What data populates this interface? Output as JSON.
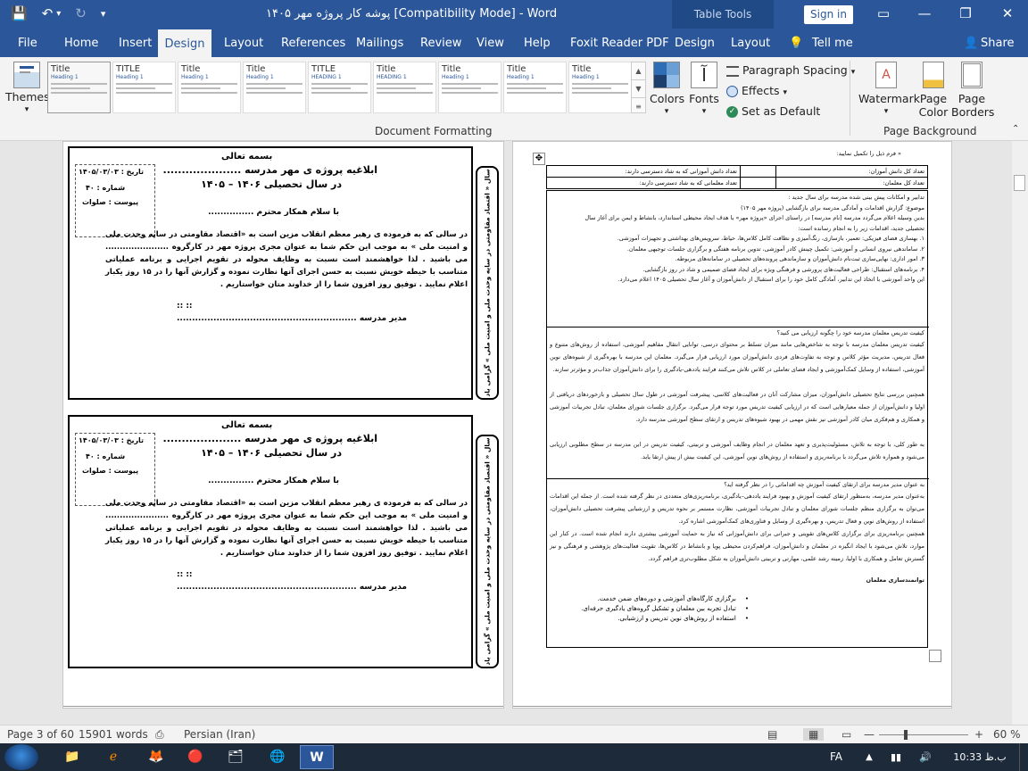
{
  "window": {
    "title": "پوشه کار پروژه مهر ۱۴۰۵ [Compatibility Mode]  -  Word",
    "contextual": "Table Tools",
    "signin": "Sign in",
    "minimize": "—",
    "restore": "❐",
    "close": "✕"
  },
  "qat": {
    "save": "💾",
    "undo": "↶",
    "undo_dd": "▾",
    "redo": "↻",
    "customize": "▾"
  },
  "tabs": [
    "File",
    "Home",
    "Insert",
    "Design",
    "Layout",
    "References",
    "Mailings",
    "Review",
    "View",
    "Help",
    "Foxit Reader PDF",
    "Design",
    "Layout",
    "Tell me",
    "Share"
  ],
  "tell_icon": "💡",
  "share_icon": "👤",
  "ribbon": {
    "themes": "Themes",
    "themes_dd": "▾",
    "styles": [
      {
        "t": "Title",
        "h": "Heading 1"
      },
      {
        "t": "TITLE",
        "h": "Heading 1"
      },
      {
        "t": "Title",
        "h": "Heading 1"
      },
      {
        "t": "Title",
        "h": "Heading 1"
      },
      {
        "t": "TITLE",
        "h": "HEADING 1"
      },
      {
        "t": "Title",
        "h": "HEADING 1"
      },
      {
        "t": "Title",
        "h": "Heading 1"
      },
      {
        "t": "Title",
        "h": "Heading 1"
      },
      {
        "t": "Title",
        "h": "Heading 1"
      }
    ],
    "gallery_up": "▲",
    "gallery_down": "▼",
    "gallery_more": "≡",
    "colors": "Colors",
    "fonts": "Fonts",
    "fonts_glyph": "آ",
    "paragraph_spacing": "Paragraph Spacing",
    "effects": "Effects",
    "set_default": "Set as Default",
    "dd": "▾",
    "doc_formatting": "Document Formatting",
    "watermark": "Watermark",
    "page_color": "Page Color",
    "page_color2": "Color",
    "page_borders": "Page Borders",
    "page_borders2": "Borders",
    "page_color1": "Page",
    "page_borders1": "Page",
    "page_background": "Page Background",
    "collapse": "⌃"
  },
  "doc": {
    "card": {
      "basmala": "بسمه تعالی",
      "title1": "ابلاغیه پروژه ی مهر مدرسه  .....................",
      "title2": "در سال تحصیلی ۱۴۰۶ – ۱۴۰۵",
      "date": "تاریخ : ۱۴۰۵/۰۳/۰۳",
      "number": "شماره : ۴۰",
      "attach": "پیوست : صلوات",
      "greet": "با سلام همکار محترم ...............",
      "body": "در سالی که به فرموده ی رهبر معظم انقلاب مزین است به «اقتصاد مقاومتی در سایه وحدت ملی و امنیت ملی » به موجب این حکم شما به عنوان مجری پروژه مهر در کارگروه ...................... می باشید . لذا خواهشمند است نسبت به وظایف محوله در تقویم اجرایی و برنامه عملیاتی متناسب با حیطه خویش نسبت به حسن اجرای آنها نظارت نموده و گزارش آنها را در ۱۵ روز یکبار اعلام نمایید .  توفیق روز افزون شما را از خداوند متان خواستاریم .",
      "dots": "::                                ::",
      "manager": "مدیر  مدرسه  ...........................................................",
      "side": "سال « اقتصاد مقاومتی در سایه وحدت ملی و امنیت ملی » گرامی باد"
    },
    "right": {
      "intro": "« فرم ذیل را تکمیل نمایید:",
      "t_r1c1": "تعداد کل دانش آموزان:",
      "t_r1c2": "تعداد دانش آموزانی که به شاد دسترسی دارند:",
      "t_r2c1": "تعداد کل معلمان:",
      "t_r2c2": "تعداد معلمانی که به شاد دسترسی دارند:",
      "s1": [
        "تدابیر و امکانات پیش بینی شده مدرسه برای سال جدید :",
        "موضوع: گزارش اقدامات و آمادگی مدرسه برای بازگشایی (پروژه مهر ۱۴۰۵)",
        "بدین وسیله اعلام می‌گردد مدرسه [نام مدرسه] در راستای اجرای «پروژه مهر» با هدف ایجاد محیطی استاندارد، بانشاط و ایمن برای آغاز سال",
        "تحصیلی جدید، اقدامات زیر را به انجام رسانده است:",
        "۱. بهسازی فضای فیزیکی: تعمیر، بازسازی، رنگ‌آمیزی و نظافت کامل کلاس‌ها، حیاط، سرویس‌های بهداشتی و تجهیزات آموزشی.",
        "۲. ساماندهی نیروی انسانی و آموزشی: تکمیل چینش کادر آموزشی، تدوین برنامه هفتگی و برگزاری جلسات توجیهی معلمان.",
        "۳. امور اداری: نهایی‌سازی ثبت‌نام دانش‌آموزان و سازماندهی پرونده‌های تحصیلی در سامانه‌های مربوطه.",
        "۴. برنامه‌های استقبال: طراحی فعالیت‌های پرورشی و فرهنگی ویژه برای ایجاد فضای صمیمی و شاد در روز بازگشایی.",
        "این واحد آموزشی با اتخاذ این تدابیر، آمادگی کامل خود را برای استقبال از دانش‌آموزان و آغاز سال تحصیلی ۱۴۰۵ اعلام می‌دارد."
      ],
      "s2_q": "کیفیت تدریس معلمان مدرسه خود را چگونه ارزیابی می کنید؟",
      "s2_p1": "کیفیت تدریس معلمان مدرسه با توجه به شاخص‌هایی مانند میزان تسلط بر محتوای درسی، توانایی انتقال مفاهیم آموزشی، استفاده از روش‌های متنوع و فعال تدریس، مدیریت مؤثر کلاس و توجه به تفاوت‌های فردی دانش‌آموزان مورد ارزیابی قرار می‌گیرد. معلمان این مدرسه با بهره‌گیری از شیوه‌های نوین آموزشی، استفاده از وسایل کمک‌آموزشی و ایجاد فضای تعاملی در کلاس تلاش می‌کنند فرایند یاددهی-یادگیری را برای دانش‌آموزان جذاب‌تر و مؤثرتر سازند.",
      "s2_p2": "همچنین بررسی نتایج تحصیلی دانش‌آموزان، میزان مشارکت آنان در فعالیت‌های کلاسی، پیشرفت آموزشی در طول سال تحصیلی و بازخوردهای دریافتی از اولیا و دانش‌آموزان از جمله معیارهایی است که در ارزیابی کیفیت تدریس مورد توجه قرار می‌گیرد. برگزاری جلسات شورای معلمان، تبادل تجربیات آموزشی و همکاری و هم‌فکری میان کادر آموزشی نیز نقش مهمی در بهبود شیوه‌های تدریس و ارتقای سطح آموزشی مدرسه دارد.",
      "s2_p3": "به طور کلی، با توجه به تلاش، مسئولیت‌پذیری و تعهد معلمان در انجام وظایف آموزشی و تربیتی، کیفیت تدریس در این مدرسه در سطح مطلوبی ارزیابی می‌شود و همواره تلاش می‌گردد با برنامه‌ریزی و استفاده از روش‌های نوین آموزشی، این کیفیت بیش از پیش ارتقا یابد.",
      "s3_q": "به عنوان مدیر مدرسه برای ارتقای کیفیت آموزش چه اقداماتی را در نظر گرفته اید؟",
      "s3_p1": "به‌عنوان مدیر مدرسه، به‌منظور ارتقای کیفیت آموزش و بهبود فرایند یاددهی–یادگیری، برنامه‌ریزی‌های متعددی در نظر گرفته شده است. از جمله این اقدامات می‌توان به برگزاری منظم جلسات شورای معلمان و تبادل تجربیات آموزشی، نظارت مستمر بر نحوه تدریس و ارزشیابی پیشرفت تحصیلی دانش‌آموزان، استفاده از روش‌های نوین و فعال تدریس، و بهره‌گیری از وسایل و فناوری‌های کمک‌آموزشی اشاره کرد.",
      "s3_p2": "همچنین برنامه‌ریزی برای برگزاری کلاس‌های تقویتی و جبرانی برای دانش‌آموزانی که نیاز به حمایت آموزشی بیشتری دارند انجام شده است. در کنار این موارد، تلاش می‌شود با ایجاد انگیزه در معلمان و دانش‌آموزان، فراهم‌کردن محیطی پویا و بانشاط در کلاس‌ها، تقویت فعالیت‌های پژوهشی و فرهنگی و نیز گسترش تعامل و همکاری با اولیا، زمینه رشد علمی، مهارتی و تربیتی دانش‌آموزان به شکل مطلوب‌تری فراهم گردد.",
      "s3_h": "توانمندسازی معلمان",
      "bullets": [
        "برگزاری کارگاه‌های آموزشی و دوره‌های ضمن خدمت.",
        "تبادل تجربه بین معلمان و تشکیل گروه‌های یادگیری حرفه‌ای.",
        "استفاده از روش‌های نوین تدریس و ارزشیابی."
      ],
      "bullet": "•",
      "move": "✥"
    }
  },
  "status": {
    "page": "Page 3 of 60",
    "words": "15901 words",
    "lang": "Persian (Iran)",
    "zoom": "60 %",
    "minus": "—",
    "plus": "+",
    "zoom_pct": 0.6
  },
  "taskbar": {
    "lang": "FA",
    "time": "10:33 ب.ظ",
    "icons": [
      "📁",
      "🦊",
      "🔴",
      "🗂",
      "🌐",
      "W"
    ]
  }
}
